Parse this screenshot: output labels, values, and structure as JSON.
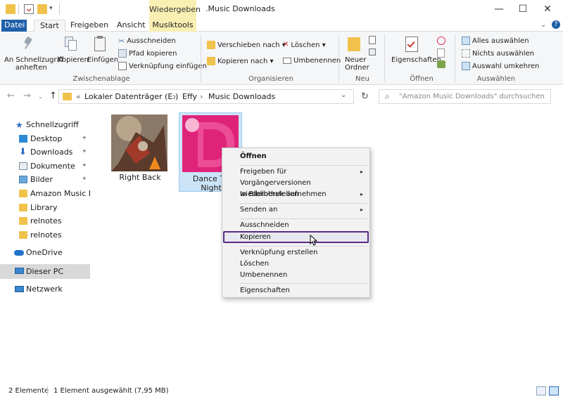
{
  "window": {
    "title": ".Music Downloads",
    "context_tab_header": "Wiedergeben",
    "controls": {
      "minimize": "—",
      "maximize": "☐",
      "close": "✕"
    }
  },
  "tabs": [
    {
      "label": "Datei"
    },
    {
      "label": "Start"
    },
    {
      "label": "Freigeben"
    },
    {
      "label": "Ansicht"
    },
    {
      "label": "Musiktools"
    }
  ],
  "ribbon": {
    "clipboard": {
      "pin_label_1": "An Schnellzugriff",
      "pin_label_2": "anheften",
      "copy": "Kopieren",
      "paste": "Einfügen",
      "cut": "Ausschneiden",
      "copy_path": "Pfad kopieren",
      "paste_shortcut": "Verknüpfung einfügen",
      "group_label": "Zwischenablage"
    },
    "organize": {
      "move_to": "Verschieben nach ▾",
      "copy_to": "Kopieren nach ▾",
      "delete": "Löschen ▾",
      "rename": "Umbenennen",
      "group_label": "Organisieren"
    },
    "new": {
      "new_folder_1": "Neuer",
      "new_folder_2": "Ordner",
      "group_label": "Neu"
    },
    "open": {
      "properties": "Eigenschaften",
      "group_label": "Öffnen"
    },
    "select": {
      "select_all": "Alles auswählen",
      "select_none": "Nichts auswählen",
      "invert": "Auswahl umkehren",
      "group_label": "Auswählen"
    }
  },
  "address": {
    "back": "←",
    "forward": "→",
    "up": "↑",
    "chevron": "«",
    "crumb_1": "Lokaler Datenträger (E:)",
    "crumb_2": "Effy",
    "crumb_3": "Music Downloads",
    "sep": "›",
    "search_placeholder": "\"Amazon Music Downloads\" durchsuchen"
  },
  "sidebar": {
    "items": [
      {
        "label": "Schnellzugriff"
      },
      {
        "label": "Desktop"
      },
      {
        "label": "Downloads"
      },
      {
        "label": "Dokumente"
      },
      {
        "label": "Bilder"
      },
      {
        "label": "Amazon Music Dov"
      },
      {
        "label": "Library"
      },
      {
        "label": "relnotes"
      },
      {
        "label": "relnotes"
      },
      {
        "label": "OneDrive"
      },
      {
        "label": "Dieser PC"
      },
      {
        "label": "Netzwerk"
      }
    ],
    "pin_glyph": "📌"
  },
  "files": [
    {
      "name": "Right Back",
      "selected": false
    },
    {
      "name_line1": "Dance Th",
      "name_line2": "Night",
      "selected": true
    }
  ],
  "context_menu": {
    "items": [
      {
        "label": "Öffnen"
      },
      {
        "label": "Freigeben für"
      },
      {
        "label": "Vorgängerversionen wiederherstellen"
      },
      {
        "label": "In Bibliothek aufnehmen"
      },
      {
        "label": "Senden an"
      },
      {
        "label": "Ausschneiden"
      },
      {
        "label": "Kopieren"
      },
      {
        "label": "Verknüpfung erstellen"
      },
      {
        "label": "Löschen"
      },
      {
        "label": "Umbenennen"
      },
      {
        "label": "Eigenschaften"
      }
    ],
    "submenu_arrow": "▸"
  },
  "status": {
    "count": "2 Elemente",
    "selection": "1 Element ausgewählt (7,95 MB)"
  },
  "colors": {
    "accent": "#1f5fa8",
    "context_tab": "#f9efb3",
    "selection": "#cce4f7",
    "menu_highlight_border": "#5b2a86",
    "folder": "#f0c24b",
    "album_pink": "#e0237a"
  }
}
